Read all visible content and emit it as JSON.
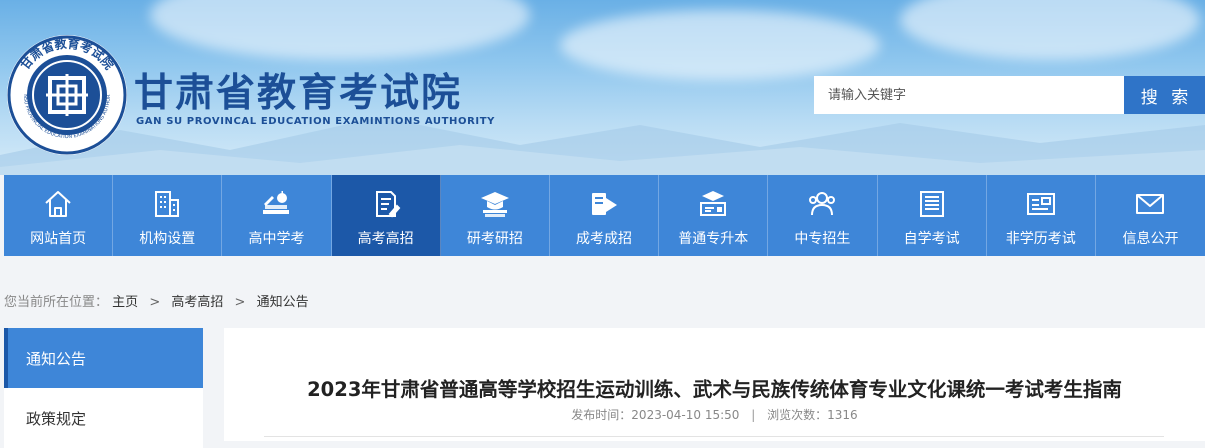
{
  "header": {
    "site_title": "甘肃省教育考试院",
    "site_subtitle": "GAN SU PROVINCAL EDUCATION EXAMINTIONS AUTHORITY",
    "logo_text": "甘肃省教育考试院",
    "logo_text_en": "GANSU PROVINCIAL EDUCATION EXAMINATIONS AUTHORITY",
    "brand_color": "#1c4f97"
  },
  "search": {
    "placeholder": "请输入关键字",
    "value": "",
    "button_label": "搜 索"
  },
  "nav": {
    "items": [
      {
        "label": "网站首页",
        "icon": "home-icon"
      },
      {
        "label": "机构设置",
        "icon": "building-icon"
      },
      {
        "label": "高中学考",
        "icon": "books-apple-icon"
      },
      {
        "label": "高考高招",
        "icon": "exam-paper-icon",
        "active": true
      },
      {
        "label": "研考研招",
        "icon": "graduation-cap-icon"
      },
      {
        "label": "成考成招",
        "icon": "open-book-icon"
      },
      {
        "label": "普通专升本",
        "icon": "teacher-board-icon"
      },
      {
        "label": "中专招生",
        "icon": "users-icon"
      },
      {
        "label": "自学考试",
        "icon": "document-list-icon"
      },
      {
        "label": "非学历考试",
        "icon": "certificate-icon"
      },
      {
        "label": "信息公开",
        "icon": "mail-icon"
      }
    ],
    "color": "#3e86d8",
    "active_color": "#1c58a8"
  },
  "breadcrumb": {
    "prefix": "您当前所在位置：",
    "items": [
      "主页",
      "高考高招",
      "通知公告"
    ],
    "separator": ">"
  },
  "sidebar": {
    "items": [
      {
        "label": "通知公告",
        "active": true
      },
      {
        "label": "政策规定",
        "active": false
      }
    ]
  },
  "article": {
    "title": "2023年甘肃省普通高等学校招生运动训练、武术与民族传统体育专业文化课统一考试考生指南",
    "published_label": "发布时间：",
    "published": "2023-04-10 15:50",
    "meta_separator": "|",
    "views_label": "浏览次数：",
    "views": "1316"
  }
}
